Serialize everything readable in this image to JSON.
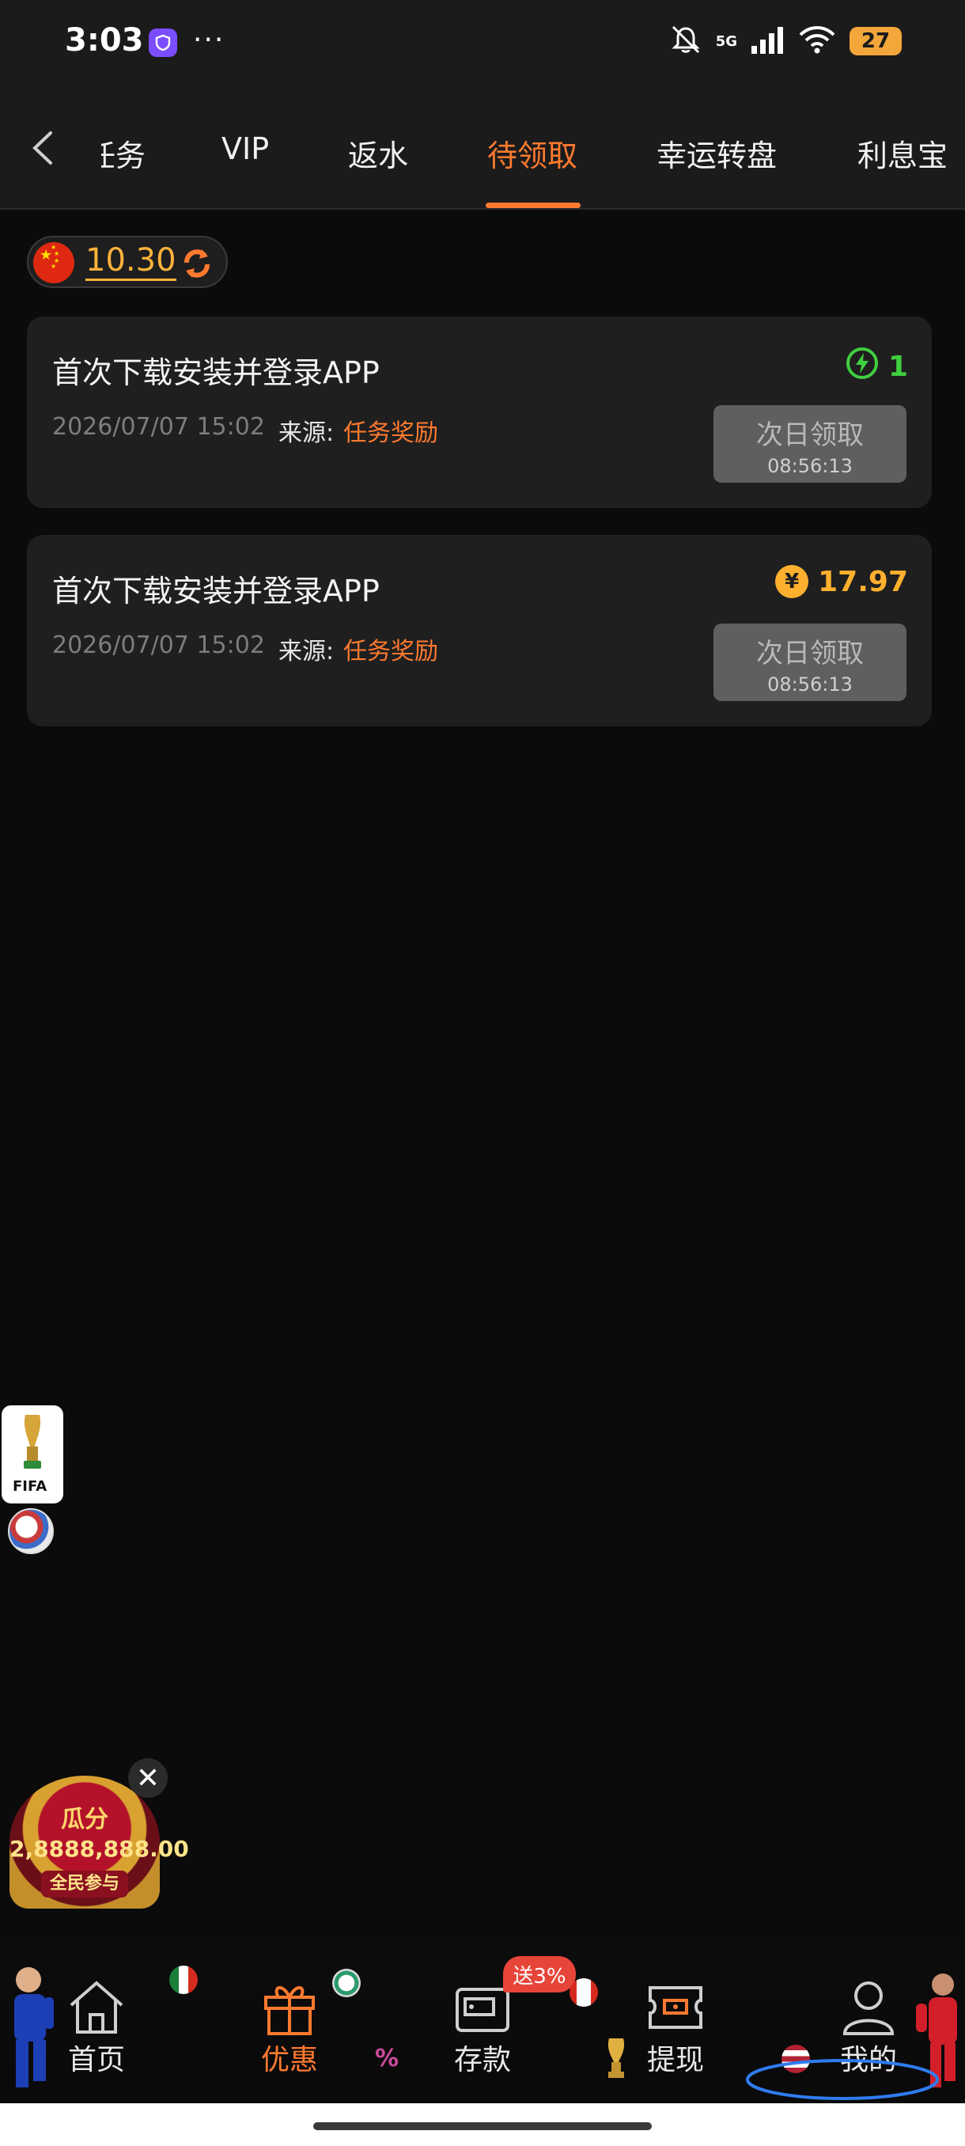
{
  "status_bar": {
    "time": "3:03",
    "more": "···",
    "network": "5G",
    "battery": "27",
    "icons": [
      "app-shield-icon",
      "mute-icon",
      "signal-icon",
      "wifi-icon",
      "battery-icon"
    ]
  },
  "tabs": {
    "items": [
      {
        "label": "任务",
        "active": false
      },
      {
        "label": "VIP",
        "active": false
      },
      {
        "label": "返水",
        "active": false
      },
      {
        "label": "待领取",
        "active": true
      },
      {
        "label": "幸运转盘",
        "active": false
      },
      {
        "label": "利息宝",
        "active": false
      }
    ],
    "accent": "#ff7a2f"
  },
  "balance": {
    "amount": "10.30",
    "currency_flag": "china-flag-icon"
  },
  "cards": [
    {
      "title": "首次下载安装并登录APP",
      "date": "2026/07/07 15:02",
      "source_label": "来源:",
      "source_value": "任务奖励",
      "reward_value": "1",
      "reward_icon": "lightning-icon",
      "reward_color": "#3fcf3f",
      "button_label": "次日领取",
      "button_timer": "08:56:13"
    },
    {
      "title": "首次下载安装并登录APP",
      "date": "2026/07/07 15:02",
      "source_label": "来源:",
      "source_value": "任务奖励",
      "reward_value": "17.97",
      "reward_icon": "yuan-coin-icon",
      "reward_symbol": "¥",
      "reward_color": "#ffb02e",
      "button_label": "次日领取",
      "button_timer": "08:56:13"
    }
  ],
  "widgets": {
    "fifa_label": "FIFA",
    "promo": {
      "top": "瓜分",
      "amount": "2,8888,888.00",
      "join": "全民参与",
      "close": "✕"
    }
  },
  "bottom_nav": {
    "items": [
      {
        "label": "首页",
        "icon": "home-icon",
        "active": false
      },
      {
        "label": "优惠",
        "icon": "gift-icon",
        "active": true
      },
      {
        "label": "存款",
        "icon": "wallet-icon",
        "active": false
      },
      {
        "label": "提现",
        "icon": "ticket-icon",
        "active": false
      },
      {
        "label": "我的",
        "icon": "user-icon",
        "active": false
      }
    ],
    "bonus_badge": "送3%"
  }
}
